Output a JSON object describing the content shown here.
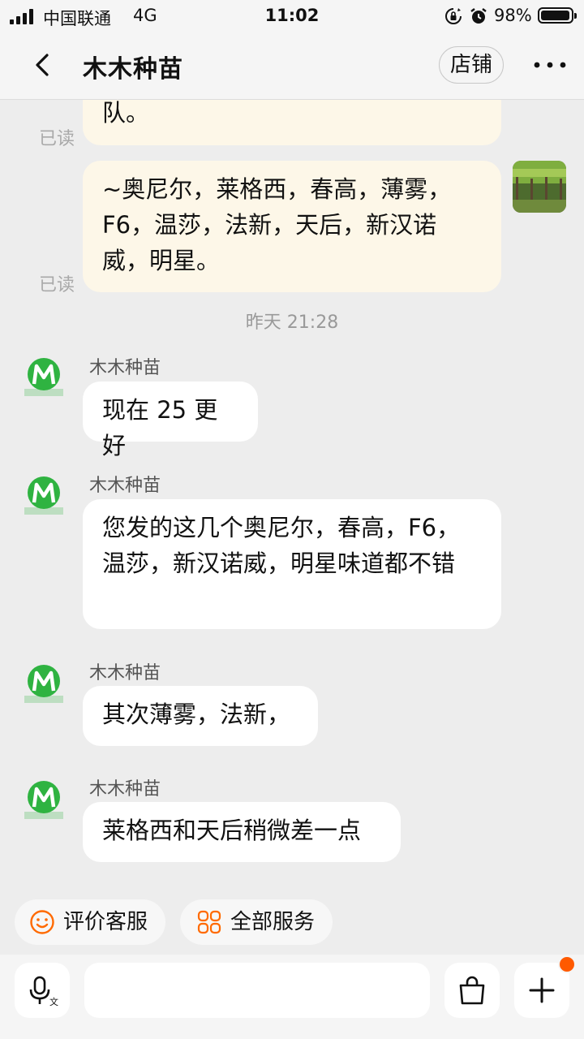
{
  "status_bar": {
    "carrier": "中国联通",
    "network": "4G",
    "time": "11:02",
    "battery_percent": "98%",
    "battery_level": 0.98,
    "signal_bars": 4
  },
  "header": {
    "title": "木木种苗",
    "shop_button": "店铺",
    "more_icon": "more-dots-icon",
    "back_icon": "chevron-left-icon"
  },
  "messages": {
    "out1": {
      "text": "队。",
      "read": "已读"
    },
    "out2": {
      "text": "~奥尼尔，莱格西，春高，薄雾，F6，温莎，法新，天后，新汉诺威，明星。",
      "read": "已读"
    },
    "timestamp": "昨天 21:28",
    "in1": {
      "sender": "木木种苗",
      "text": "现在 25 更好"
    },
    "in2": {
      "sender": "木木种苗",
      "text": "您发的这几个奥尼尔，春高，F6，温莎，新汉诺威，明星味道都不错"
    },
    "in3": {
      "sender": "木木种苗",
      "text": "其次薄雾，法新，"
    },
    "in4": {
      "sender": "木木种苗",
      "text": "莱格西和天后稍微差一点"
    }
  },
  "quick_actions": [
    {
      "label": "评价客服",
      "icon": "smiley-icon"
    },
    {
      "label": "全部服务",
      "icon": "grid-services-icon"
    }
  ],
  "input_bar": {
    "placeholder": "",
    "voice_icon": "voice-input-icon",
    "emoji_icon": "emoji-icon",
    "bag_icon": "shopping-bag-icon",
    "plus_icon": "plus-icon"
  },
  "colors": {
    "outgoing_bubble": "#fdf7e8",
    "incoming_bubble": "#ffffff",
    "background": "#ededed",
    "accent_orange": "#ff5a00",
    "logo_green": "#2fb341"
  }
}
